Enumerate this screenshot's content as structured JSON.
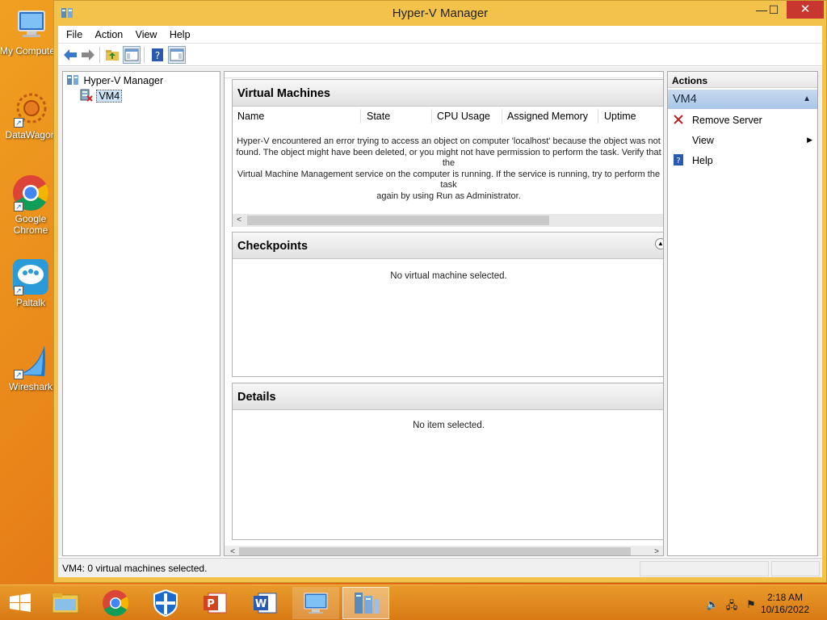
{
  "desktop": {
    "icons": [
      {
        "label": "My Computer"
      },
      {
        "label": "DataWagon"
      },
      {
        "label": "Google Chrome"
      },
      {
        "label": "Paltalk"
      },
      {
        "label": "Wireshark"
      }
    ]
  },
  "window": {
    "title": "Hyper-V Manager",
    "controls": {
      "minimize": "—",
      "maximize": "☐",
      "close": "✕"
    }
  },
  "menu": [
    "File",
    "Action",
    "View",
    "Help"
  ],
  "tree": {
    "root": "Hyper-V Manager",
    "child": "VM4"
  },
  "virtual_machines": {
    "title": "Virtual Machines",
    "columns": [
      "Name",
      "State",
      "CPU Usage",
      "Assigned Memory",
      "Uptime"
    ],
    "error_lines": [
      "Hyper-V encountered an error trying to access an object on computer 'localhost' because the object was not",
      "found. The object might have been deleted, or you might not have permission to perform the task. Verify that the",
      "Virtual Machine Management service on the computer is running. If the service is running, try to perform the task",
      "again by using Run as Administrator."
    ]
  },
  "checkpoints": {
    "title": "Checkpoints",
    "message": "No virtual machine selected."
  },
  "details": {
    "title": "Details",
    "message": "No item selected."
  },
  "actions": {
    "title": "Actions",
    "section": "VM4",
    "items": [
      {
        "label": "Remove Server",
        "icon": "remove-icon"
      },
      {
        "label": "View",
        "icon": "none"
      },
      {
        "label": "Help",
        "icon": "help-icon"
      }
    ]
  },
  "status": {
    "text": "VM4:  0 virtual machines selected."
  },
  "taskbar": {
    "time": "2:18 AM",
    "date": "10/16/2022"
  },
  "colors": {
    "accent_window": "#f3c24a",
    "close_button": "#c7372f",
    "actions_section": "#b8d0ec"
  }
}
